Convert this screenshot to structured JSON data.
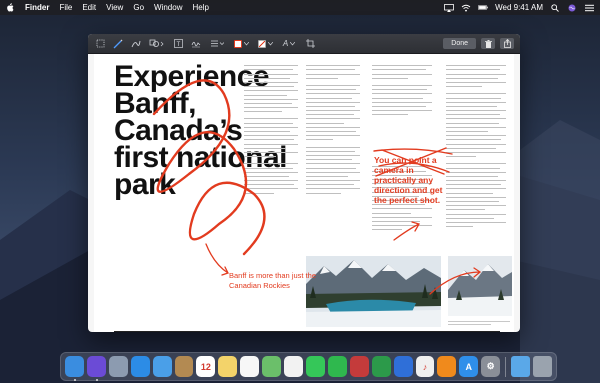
{
  "menubar": {
    "app_name": "Finder",
    "items": [
      "File",
      "Edit",
      "View",
      "Go",
      "Window",
      "Help"
    ],
    "clock": "Wed 9:41 AM"
  },
  "toolbar": {
    "done_label": "Done",
    "accent_color": "#e23b1f"
  },
  "document": {
    "headline": [
      "Experience",
      "Banff,",
      "Canada’s",
      "first national",
      "park"
    ],
    "pull_quote": "You can point a camera in practically any direction and get the perfect shot.",
    "callout": "Banff is more than just the Canadian Rockies"
  },
  "dock": {
    "apps": [
      {
        "name": "finder-icon",
        "color": "#3a8de0",
        "glyph": ""
      },
      {
        "name": "siri-icon",
        "color": "#6b4bd6",
        "glyph": ""
      },
      {
        "name": "launchpad-icon",
        "color": "#8c9bb0",
        "glyph": ""
      },
      {
        "name": "safari-icon",
        "color": "#2c8ce6",
        "glyph": ""
      },
      {
        "name": "mail-icon",
        "color": "#4a9fe8",
        "glyph": ""
      },
      {
        "name": "contacts-icon",
        "color": "#b38a52",
        "glyph": ""
      },
      {
        "name": "calendar-icon",
        "color": "#ffffff",
        "glyph": "12"
      },
      {
        "name": "notes-icon",
        "color": "#f3d36a",
        "glyph": ""
      },
      {
        "name": "reminders-icon",
        "color": "#f7f7f7",
        "glyph": ""
      },
      {
        "name": "maps-icon",
        "color": "#6bbf6a",
        "glyph": ""
      },
      {
        "name": "photos-icon",
        "color": "#f2f2f2",
        "glyph": ""
      },
      {
        "name": "messages-icon",
        "color": "#35c759",
        "glyph": ""
      },
      {
        "name": "facetime-icon",
        "color": "#2fb84e",
        "glyph": ""
      },
      {
        "name": "photo-booth-icon",
        "color": "#c43b3b",
        "glyph": ""
      },
      {
        "name": "numbers-icon",
        "color": "#2c9a4a",
        "glyph": ""
      },
      {
        "name": "keynote-icon",
        "color": "#2f6fd8",
        "glyph": ""
      },
      {
        "name": "itunes-icon",
        "color": "#f0f0f0",
        "glyph": "♪"
      },
      {
        "name": "books-icon",
        "color": "#f08a1c",
        "glyph": ""
      },
      {
        "name": "app-store-icon",
        "color": "#2f8fea",
        "glyph": "A"
      },
      {
        "name": "system-preferences-icon",
        "color": "#8a8f98",
        "glyph": "⚙"
      }
    ],
    "trailing": [
      {
        "name": "downloads-folder-icon",
        "color": "#5aa8e8"
      },
      {
        "name": "trash-icon",
        "color": "#9aa3ae"
      }
    ]
  }
}
